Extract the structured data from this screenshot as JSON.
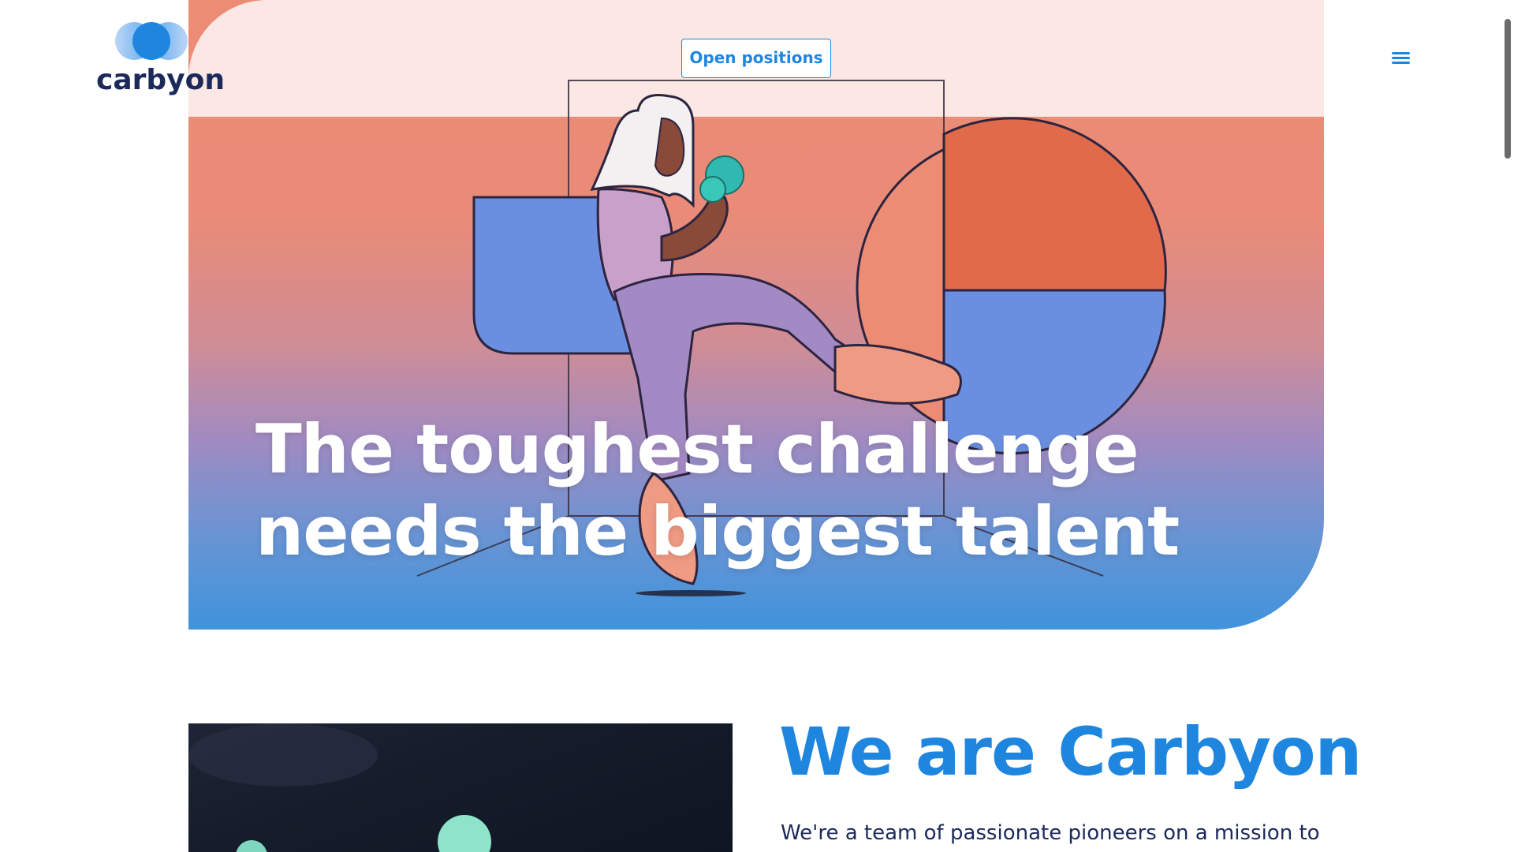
{
  "brand": {
    "name": "carbyon",
    "logo_icon": "carbyon-circles-logo"
  },
  "header": {
    "cta_label": "Open positions",
    "menu_icon": "hamburger-menu-icon"
  },
  "hero": {
    "headline_line1": "The toughest challenge",
    "headline_line2": "needs the biggest talent"
  },
  "about": {
    "title": "We are Carbyon",
    "text": "We're a team of passionate pioneers on a mission to"
  },
  "colors": {
    "accent": "#1f86e0",
    "navy": "#1b2a5a",
    "hero_top": "#fbe7e3",
    "coral": "#e06a4a",
    "blue_shape": "#6b8fe0"
  }
}
